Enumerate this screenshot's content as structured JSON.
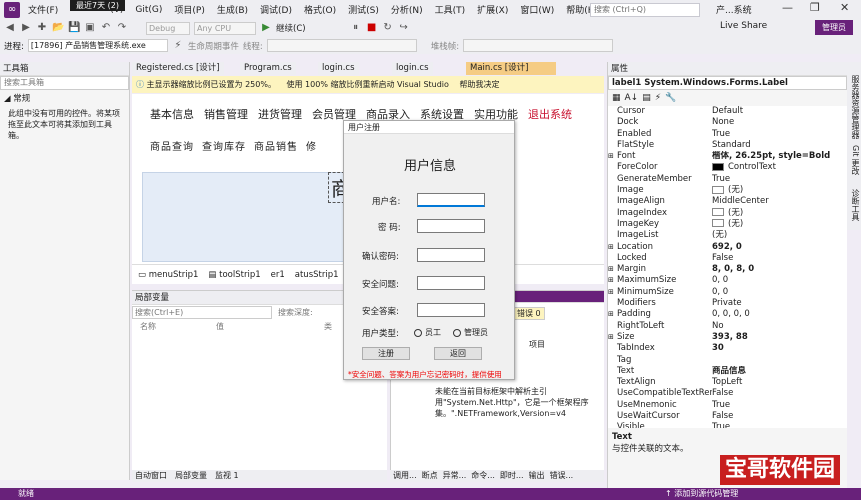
{
  "menubar": {
    "items": [
      "文件(F)",
      "(V)",
      "Git(G)",
      "项目(P)",
      "生成(B)",
      "调试(D)",
      "格式(O)",
      "测试(S)",
      "分析(N)",
      "工具(T)",
      "扩展(X)",
      "窗口(W)",
      "帮助(H)"
    ],
    "tooltip": "最近7天 (2)",
    "search_placeholder": "搜索 (Ctrl+Q)",
    "app_name": "产...系统",
    "window_controls": [
      "—",
      "❐",
      "✕"
    ]
  },
  "toolbar": {
    "config": "Debug",
    "platform": "Any CPU",
    "continue_label": "继续(C)",
    "live_share": "Live Share",
    "admin_badge": "管理员"
  },
  "toolbar2": {
    "process_label": "进程:",
    "process_value": "[17896] 产品销售管理系统.exe",
    "lifecycle_label": "生命周期事件",
    "thread_label": "线程:",
    "stack_label": "堆栈帧:"
  },
  "toolbox": {
    "title": "工具箱",
    "search_placeholder": "搜索工具箱",
    "group": "常规",
    "empty_text": "此组中没有可用的控件。将某项拖至此文本可将其添加到工具箱。"
  },
  "side_tabs": [
    "服务器资源管理器",
    "Git 更改",
    "诊断工具"
  ],
  "doc_tabs": [
    "Registered.cs [设计]",
    "Program.cs",
    "login.cs",
    "login.cs",
    "Main.cs [设计]"
  ],
  "infobar": {
    "message": "主显示器缩放比例已设置为 250%。",
    "action1": "使用 100% 缩放比例重新启动 Visual Studio",
    "action2": "帮助我决定"
  },
  "designer": {
    "menu": [
      "基本信息",
      "销售管理",
      "进货管理",
      "会员管理",
      "商品录入",
      "系统设置",
      "实用功能",
      "退出系统"
    ],
    "sub_menu": [
      "商品查询",
      "查询库存",
      "商品销售",
      "修"
    ],
    "big_glyph": "商",
    "tray_items": [
      "menuStrip1",
      "toolStrip1",
      "er1",
      "atusStrip1"
    ]
  },
  "dialog": {
    "title": "用户注册",
    "heading": "用户信息",
    "labels": [
      "用户名:",
      "密  码:",
      "确认密码:",
      "安全问题:",
      "安全答案:",
      "用户类型:"
    ],
    "radio_employee": "员工",
    "radio_admin": "管理员",
    "register_button": "注册",
    "back_button": "返回",
    "warning": "*安全问题、答案为用户忘记密码时，提供使用"
  },
  "locals": {
    "title": "局部变量",
    "search_placeholder": "搜索(Ctrl+E)",
    "search_depth": "搜索深度:",
    "col_name": "名称",
    "col_value": "值",
    "col_type": "类",
    "tabs": [
      "自动窗口",
      "局部变量",
      "监视 1"
    ]
  },
  "errors": {
    "badge": "错误 0",
    "col_item": "项目",
    "text": "组\n.Ht 产品销售管理系统\n\n未能在当前目标框架中解析主引用\"System.Net.Http\"，它是一个框架程序集。\".NETFramework,Version=v4",
    "tabs": [
      "调用...",
      "断点",
      "异常...",
      "命令...",
      "即时...",
      "输出",
      "错误..."
    ]
  },
  "properties": {
    "title": "属性",
    "object": "label1  System.Windows.Forms.Label",
    "rows": [
      {
        "n": "Cursor",
        "v": "Default"
      },
      {
        "n": "Dock",
        "v": "None"
      },
      {
        "n": "Enabled",
        "v": "True"
      },
      {
        "n": "FlatStyle",
        "v": "Standard"
      },
      {
        "n": "Font",
        "v": "楷体, 26.25pt, style=Bold",
        "b": true,
        "e": true
      },
      {
        "n": "ForeColor",
        "v": "ControlText",
        "sw": "#000000"
      },
      {
        "n": "GenerateMember",
        "v": "True"
      },
      {
        "n": "Image",
        "v": "(无)",
        "sw": "#ffffff"
      },
      {
        "n": "ImageAlign",
        "v": "MiddleCenter"
      },
      {
        "n": "ImageIndex",
        "v": "(无)",
        "sw": "#ffffff"
      },
      {
        "n": "ImageKey",
        "v": "(无)",
        "sw": "#ffffff"
      },
      {
        "n": "ImageList",
        "v": "(无)"
      },
      {
        "n": "Location",
        "v": "692, 0",
        "b": true,
        "e": true
      },
      {
        "n": "Locked",
        "v": "False"
      },
      {
        "n": "Margin",
        "v": "8, 0, 8, 0",
        "b": true,
        "e": true
      },
      {
        "n": "MaximumSize",
        "v": "0, 0",
        "e": true
      },
      {
        "n": "MinimumSize",
        "v": "0, 0",
        "e": true
      },
      {
        "n": "Modifiers",
        "v": "Private"
      },
      {
        "n": "Padding",
        "v": "0, 0, 0, 0",
        "e": true
      },
      {
        "n": "RightToLeft",
        "v": "No"
      },
      {
        "n": "Size",
        "v": "393, 88",
        "b": true,
        "e": true
      },
      {
        "n": "TabIndex",
        "v": "30",
        "b": true
      },
      {
        "n": "Tag",
        "v": ""
      },
      {
        "n": "Text",
        "v": "商品信息",
        "b": true
      },
      {
        "n": "TextAlign",
        "v": "TopLeft"
      },
      {
        "n": "UseCompatibleTextRende",
        "v": "False"
      },
      {
        "n": "UseMnemonic",
        "v": "True"
      },
      {
        "n": "UseWaitCursor",
        "v": "False"
      },
      {
        "n": "Visible",
        "v": "True"
      }
    ],
    "desc_title": "Text",
    "desc_text": "与控件关联的文本。"
  },
  "statusbar": {
    "ready": "就绪",
    "source_control": "↑ 添加到源代码管理"
  },
  "watermark": "宝哥软件园",
  "colors": {
    "accent": "#68217a",
    "tab_active": "#f5cc84",
    "infobar": "#fdf4bf",
    "warning": "#ee0000"
  }
}
